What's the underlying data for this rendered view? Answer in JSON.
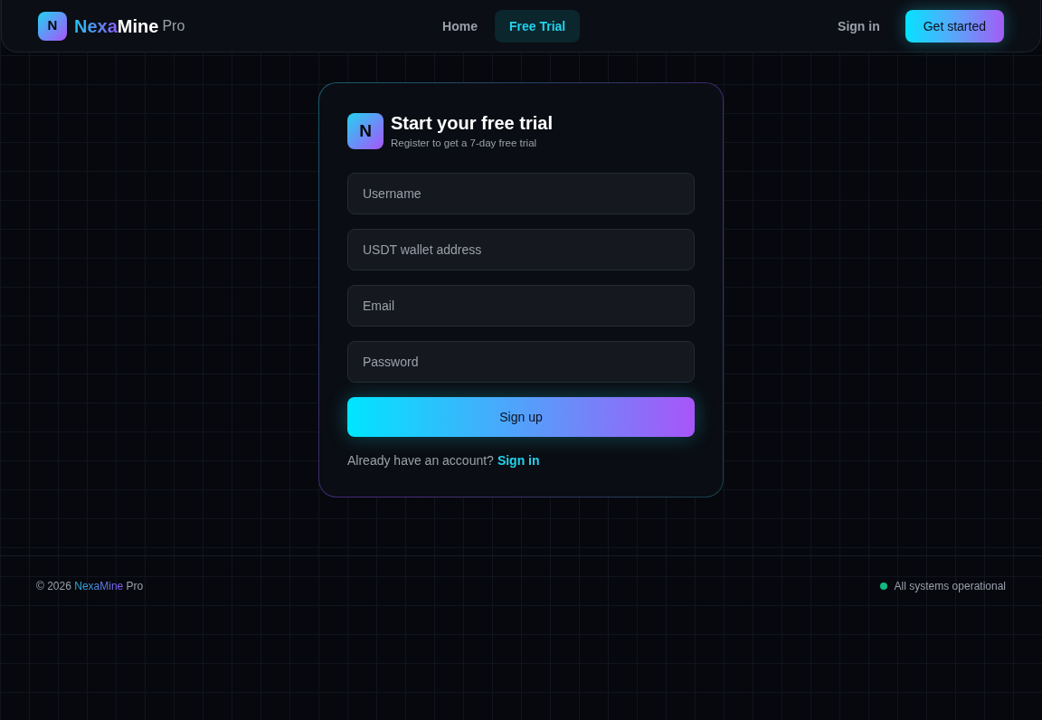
{
  "header": {
    "logo": {
      "letter": "N"
    },
    "brand": {
      "accent": "Nexa",
      "name": "Mine",
      "suffix": "Pro"
    },
    "nav": [
      {
        "label": "Home",
        "selected": false
      },
      {
        "label": "Free Trial",
        "selected": true
      }
    ],
    "actions": [
      {
        "label": "Sign in",
        "kind": "link"
      },
      {
        "label": "Get started",
        "kind": "primary"
      }
    ]
  },
  "signup_card": {
    "logo": {
      "letter": "N"
    },
    "title": "Start your free trial",
    "subtitle": "Register to get a 7-day free trial",
    "fields": [
      {
        "placeholder": "Username"
      },
      {
        "placeholder": "USDT wallet address"
      },
      {
        "placeholder": "Email"
      },
      {
        "placeholder": "Password"
      }
    ],
    "submit": "Sign up",
    "signin_prompt": {
      "text": "Already have an account?",
      "link": "Sign in"
    }
  },
  "footer": {
    "copyright": {
      "prefix": "© 2026",
      "brand": "NexaMine",
      "suffix": "Pro"
    },
    "status": {
      "text": "All systems operational",
      "color": "#10b981"
    }
  }
}
